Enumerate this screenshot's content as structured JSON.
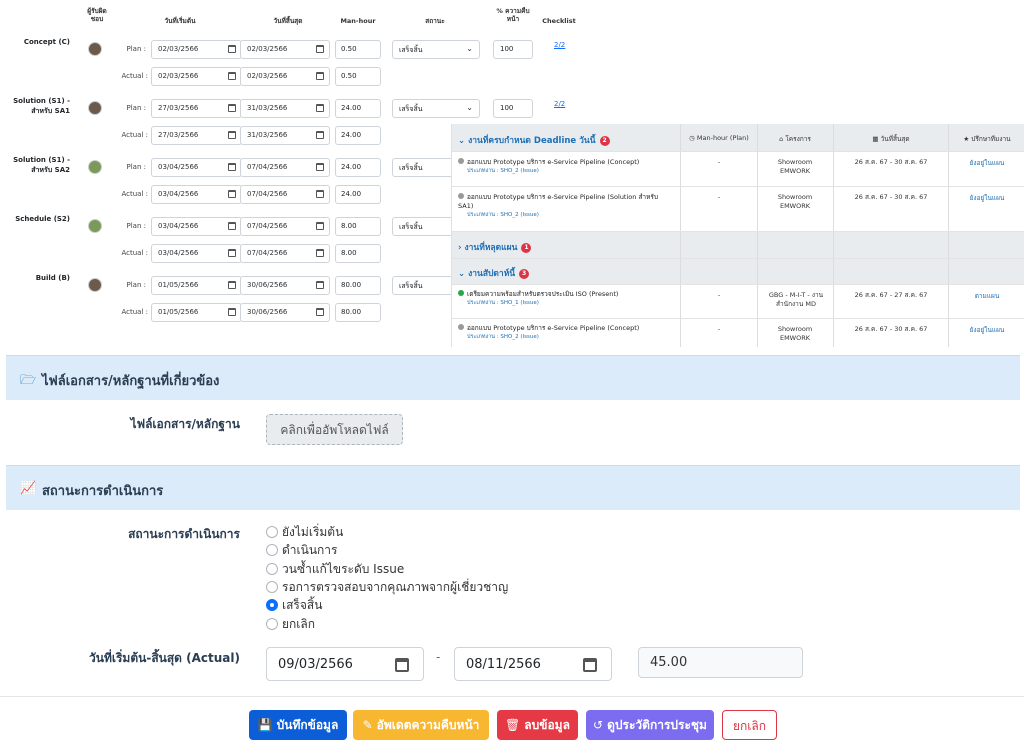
{
  "schedule": {
    "headers": {
      "owner": "ผู้รับผิดชอบ",
      "start": "วันที่เริ่มต้น",
      "end": "วันที่สิ้นสุด",
      "manhour": "Man-hour",
      "status": "สถานะ",
      "percent": "% ความคืบหน้า",
      "checklist": "Checklist"
    },
    "plan_label": "Plan :",
    "actual_label": "Actual :",
    "phases": [
      {
        "name": "Concept (C)",
        "plan_start": "02/03/2566",
        "plan_end": "02/03/2566",
        "plan_mh": "0.50",
        "status": "เสร็จสิ้น",
        "percent": "100",
        "checklist": "2/2",
        "actual_start": "02/03/2566",
        "actual_end": "02/03/2566",
        "actual_mh": "0.50"
      },
      {
        "name": "Solution (S1) - สำหรับ SA1",
        "plan_start": "27/03/2566",
        "plan_end": "31/03/2566",
        "plan_mh": "24.00",
        "status": "เสร็จสิ้น",
        "percent": "100",
        "checklist": "2/2",
        "actual_start": "27/03/2566",
        "actual_end": "31/03/2566",
        "actual_mh": "24.00"
      },
      {
        "name": "Solution (S1) - สำหรับ SA2",
        "plan_start": "03/04/2566",
        "plan_end": "07/04/2566",
        "plan_mh": "24.00",
        "status": "เสร็จสิ้น",
        "percent": "",
        "checklist": "",
        "actual_start": "03/04/2566",
        "actual_end": "07/04/2566",
        "actual_mh": "24.00"
      },
      {
        "name": "Schedule (S2)",
        "plan_start": "03/04/2566",
        "plan_end": "07/04/2566",
        "plan_mh": "8.00",
        "status": "เสร็จสิ้น",
        "percent": "",
        "checklist": "",
        "actual_start": "03/04/2566",
        "actual_end": "07/04/2566",
        "actual_mh": "8.00"
      },
      {
        "name": "Build (B)",
        "plan_start": "01/05/2566",
        "plan_end": "30/06/2566",
        "plan_mh": "80.00",
        "status": "เสร็จสิ้น",
        "percent": "",
        "checklist": "",
        "actual_start": "01/05/2566",
        "actual_end": "30/06/2566",
        "actual_mh": "80.00"
      }
    ]
  },
  "panel": {
    "col_headers": {
      "manhour": "Man-hour (Plan)",
      "project": "โครงการ",
      "dates": "วันที่สิ้นสุด",
      "consult": "ปรึกษาทีมงาน"
    },
    "groups": [
      {
        "title": "งานที่ครบกำหนด Deadline วันนี้",
        "count": "2"
      },
      {
        "title": "งานที่หลุดแผน",
        "count": "1"
      },
      {
        "title": "งานสัปดาห์นี้",
        "count": "3"
      }
    ],
    "rows": [
      {
        "title": "ออกแบบ Prototype บริการ e-Service Pipeline (Concept)",
        "sub": "ประเภทงาน : SHO_2 (Issue)",
        "mh": "-",
        "project": "Showroom EMWORK",
        "dates": "26 ส.ค. 67 - 30 ส.ค. 67",
        "link": "ยังอยู่ในแผน"
      },
      {
        "title": "ออกแบบ Prototype บริการ e-Service Pipeline (Solution สำหรับ SA1)",
        "sub": "ประเภทงาน : SHO_2 (Issue)",
        "mh": "-",
        "project": "Showroom EMWORK",
        "dates": "26 ส.ค. 67 - 30 ส.ค. 67",
        "link": "ยังอยู่ในแผน"
      },
      {
        "title": "เตรียมความพร้อมสำหรับตรวจประเมิน ISO (Present)",
        "sub": "ประเภทงาน : SHO_1 (Issue)",
        "mh": "-",
        "project": "GBG - M-I-T - งานสำนักงาน MD",
        "dates": "26 ส.ค. 67 - 27 ส.ค. 67",
        "link": "ตามแผน"
      },
      {
        "title": "ออกแบบ Prototype บริการ e-Service Pipeline (Concept)",
        "sub": "ประเภทงาน : SHO_2 (Issue)",
        "mh": "-",
        "project": "Showroom EMWORK",
        "dates": "26 ส.ค. 67 - 30 ส.ค. 67",
        "link": "ยังอยู่ในแผน"
      }
    ]
  },
  "files": {
    "section_title": "ไฟล์เอกสาร/หลักฐานที่เกี่ยวข้อง",
    "label": "ไฟล์เอกสาร/หลักฐาน",
    "upload_button": "คลิกเพื่ออัพโหลดไฟล์"
  },
  "status": {
    "section_title": "สถานะการดำเนินการ",
    "label": "สถานะการดำเนินการ",
    "options": [
      "ยังไม่เริ่มต้น",
      "ดำเนินการ",
      "วนซ้ำแก้ไขระดับ Issue",
      "รอการตรวจสอบจากคุณภาพจากผู้เชี่ยวชาญ",
      "เสร็จสิ้น",
      "ยกเลิก"
    ],
    "selected": "เสร็จสิ้น",
    "date_label": "วันที่เริ่มต้น-สิ้นสุด (Actual)",
    "start_date": "09/03/2566",
    "end_date": "08/11/2566",
    "separator": "-",
    "hours": "45.00"
  },
  "actions": {
    "save": "บันทึกข้อมูล",
    "update": "อัพเดตความคืบหน้า",
    "delete": "ลบข้อมูล",
    "history": "ดูประวัติการประชุม",
    "cancel": "ยกเลิก"
  },
  "colors": {
    "primary": "#0d6efd",
    "save": "#0b5ed7",
    "update": "#f7b731",
    "delete": "#e63946",
    "history": "#7c6cf0",
    "cancel": "#dc3545",
    "section_bg": "#dcebfa"
  }
}
